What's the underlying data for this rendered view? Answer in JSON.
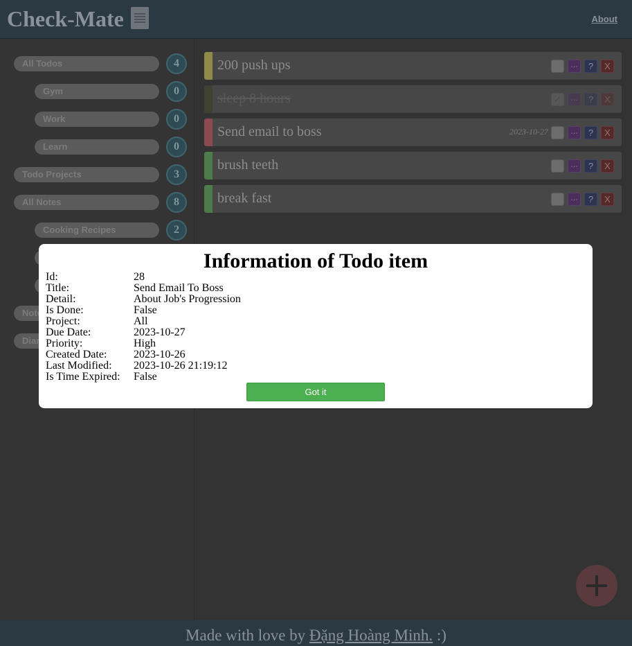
{
  "header": {
    "app_title": "Check-Mate",
    "title_icon": "document-icon",
    "about_label": "About"
  },
  "sidebar": {
    "items": [
      {
        "label": "All Todos",
        "count": "4"
      },
      {
        "label": "Gym",
        "count": "0"
      },
      {
        "label": "Work",
        "count": "0"
      },
      {
        "label": "Learn",
        "count": "0"
      },
      {
        "label": "Todo Projects",
        "count": "3"
      },
      {
        "label": "All Notes",
        "count": "8"
      },
      {
        "label": "Cooking Recipes",
        "count": "2"
      },
      {
        "label": "Notes",
        "count": ""
      },
      {
        "label": "Diaries",
        "count": ""
      }
    ]
  },
  "todos": [
    {
      "title": "200 push ups",
      "due": "",
      "done": false,
      "color": "#8f8a4a",
      "checkbox_icon": "checkbox-icon",
      "more_label": "...",
      "help_label": "?",
      "delete_label": "X"
    },
    {
      "title": "sleep 8 hours",
      "due": "",
      "done": true,
      "color": "#3e4232",
      "checkbox_mark": "✓",
      "more_label": "...",
      "help_label": "?",
      "delete_label": "X"
    },
    {
      "title": "Send email to boss",
      "due": "2023-10-27",
      "done": false,
      "color": "#8a4a4f",
      "more_label": "...",
      "help_label": "?",
      "delete_label": "X"
    },
    {
      "title": "brush teeth",
      "due": "",
      "done": false,
      "color": "#4f7a4a",
      "more_label": "...",
      "help_label": "?",
      "delete_label": "X"
    },
    {
      "title": "break fast",
      "due": "",
      "done": false,
      "color": "#4f7a4a",
      "more_label": "...",
      "help_label": "?",
      "delete_label": "X"
    }
  ],
  "modal": {
    "title": "Information of Todo item",
    "rows": [
      {
        "label": "Id:",
        "value": "28"
      },
      {
        "label": "Title:",
        "value": "Send Email To Boss"
      },
      {
        "label": "Detail:",
        "value": "About Job's Progression"
      },
      {
        "label": "Is Done:",
        "value": "False"
      },
      {
        "label": "Project:",
        "value": "All"
      },
      {
        "label": "Due Date:",
        "value": "2023-10-27"
      },
      {
        "label": "Priority:",
        "value": "High"
      },
      {
        "label": "Created Date:",
        "value": "2023-10-26"
      },
      {
        "label": "Last Modified:",
        "value": "2023-10-26 21:19:12"
      },
      {
        "label": "Is Time Expired:",
        "value": "False"
      }
    ],
    "button_label": "Got it"
  },
  "footer": {
    "prefix": "Made with love by ",
    "author": "Đặng Hoàng Minh.",
    "suffix": " :)"
  },
  "fab": {
    "icon": "plus-icon"
  }
}
